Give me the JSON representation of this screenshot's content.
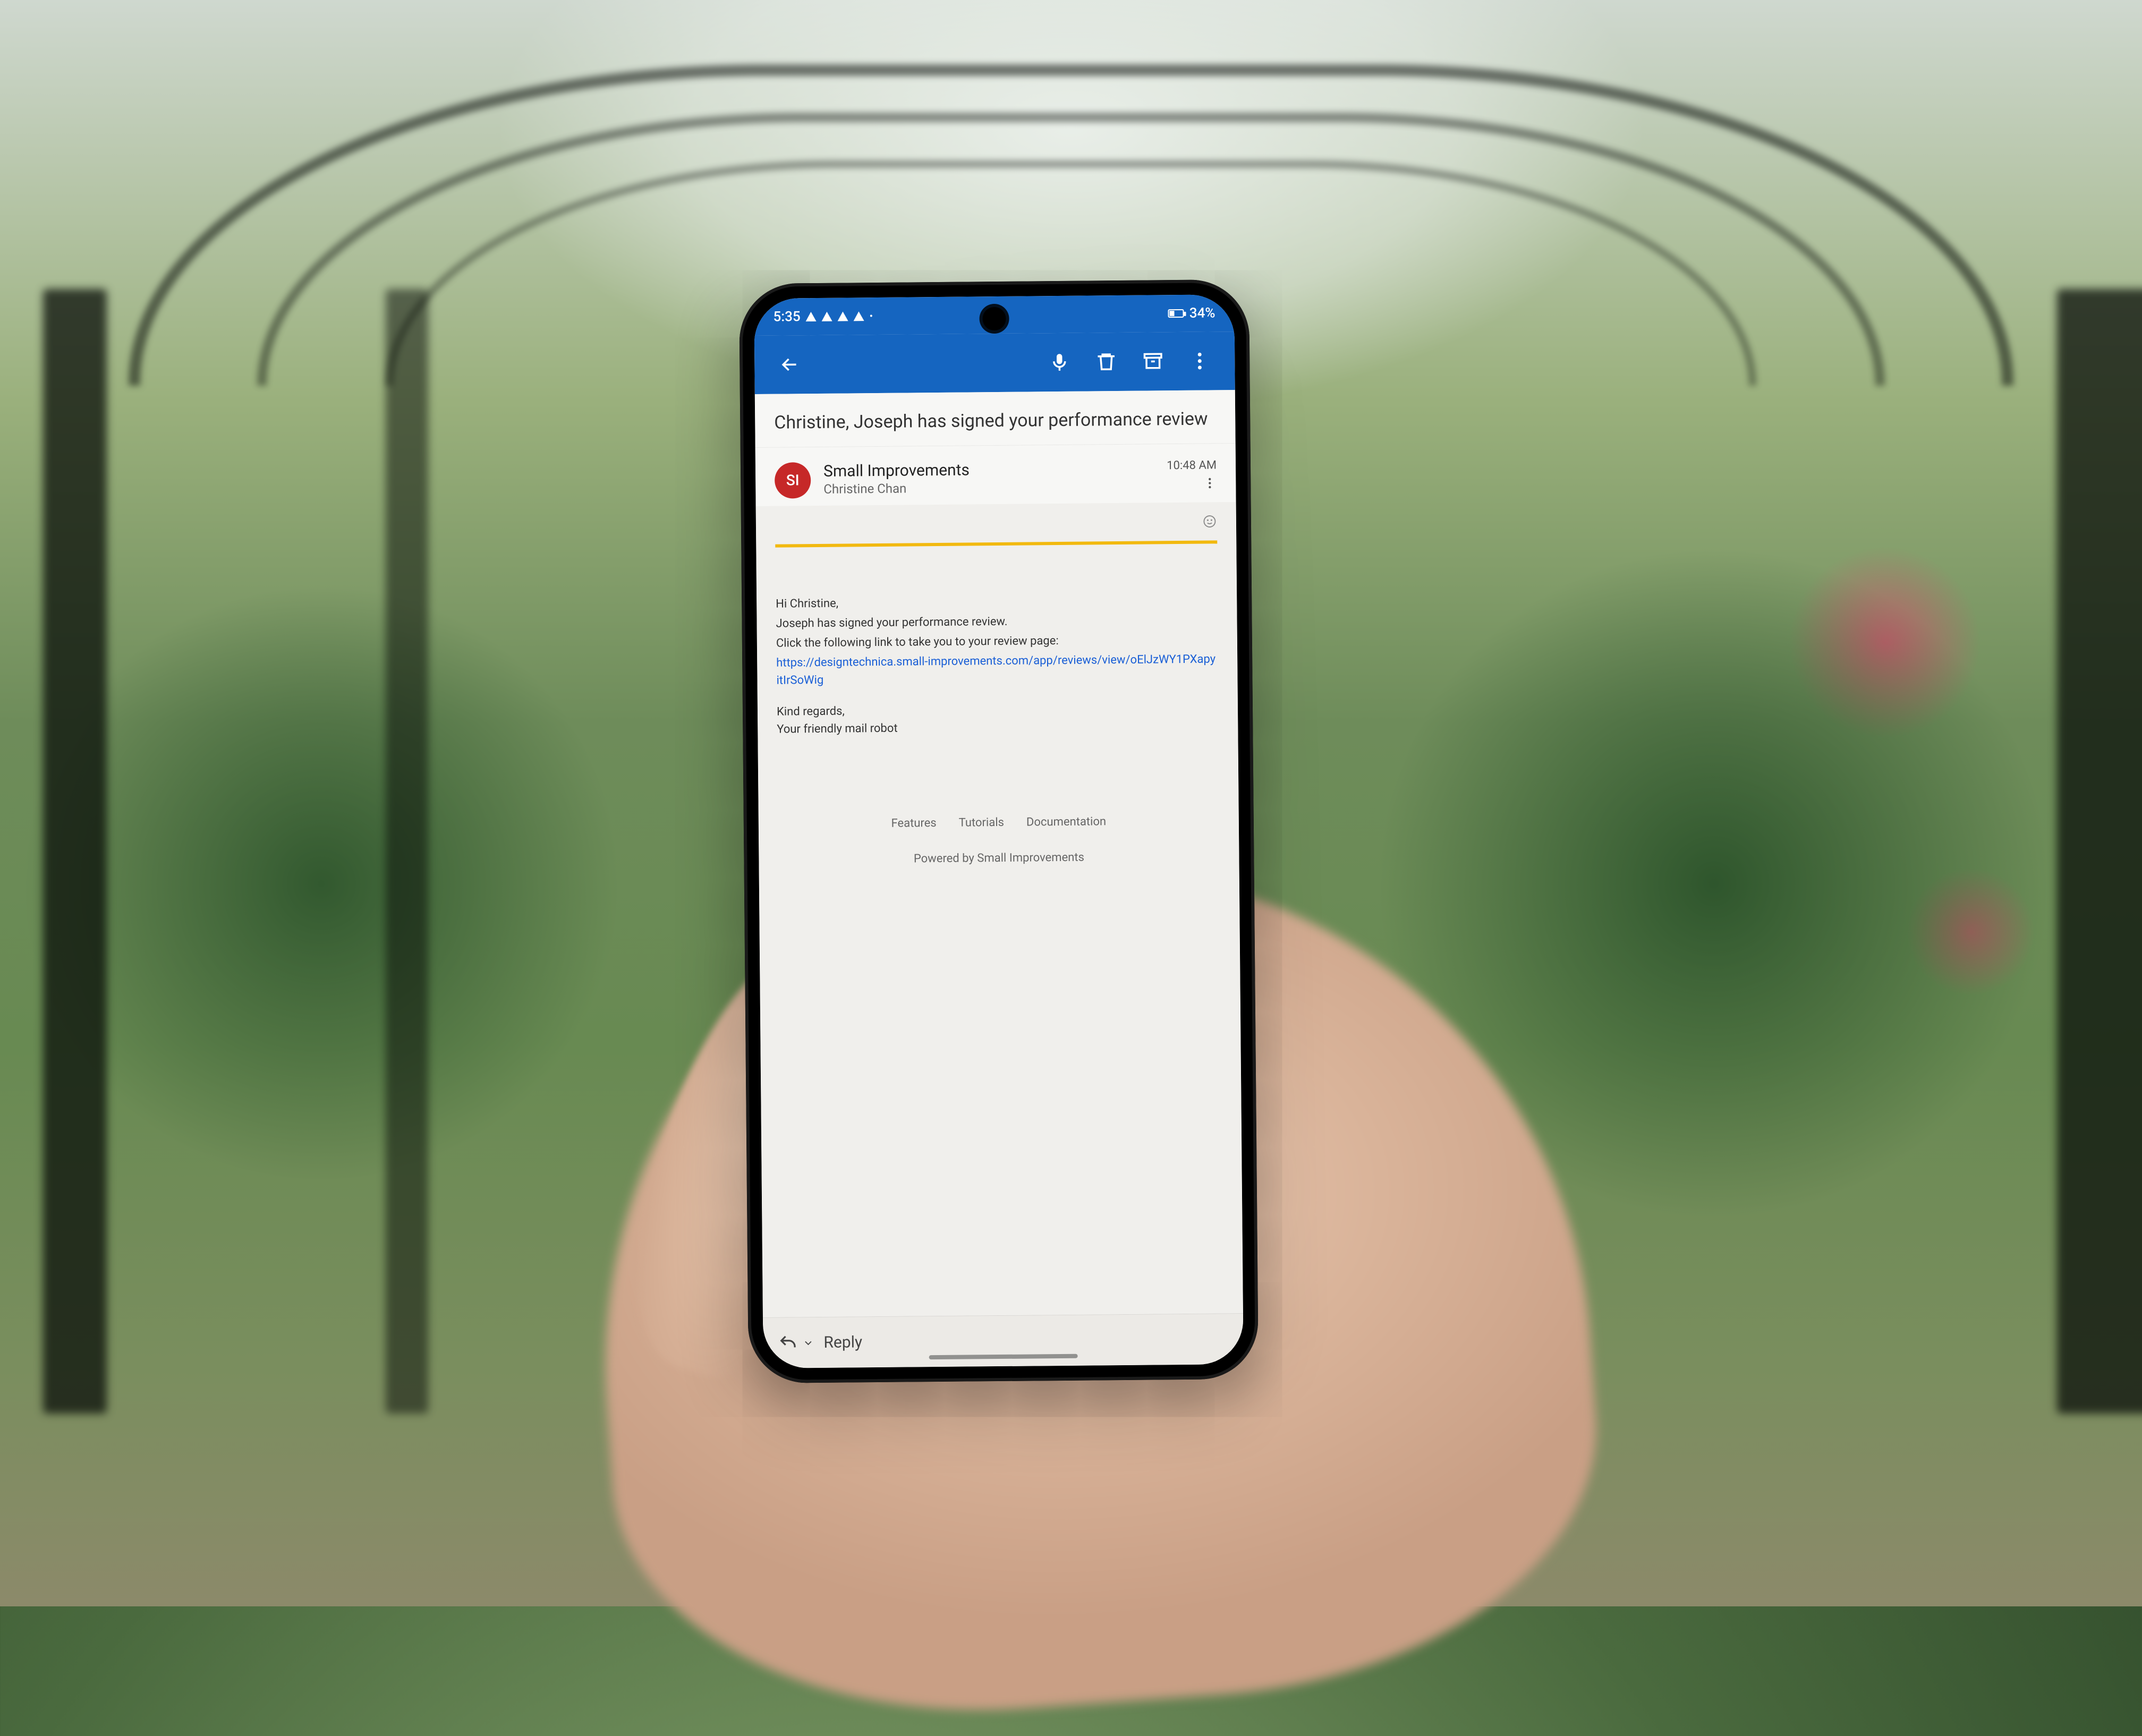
{
  "status": {
    "time": "5:35",
    "battery_pct": "34%"
  },
  "subject": "Christine, Joseph has signed your performance review",
  "sender": {
    "avatar_initials": "SI",
    "name": "Small Improvements",
    "recipient": "Christine Chan",
    "time": "10:48 AM"
  },
  "body": {
    "greeting": "Hi Christine,",
    "line1": "Joseph has signed your performance review.",
    "line2": "Click the following link to take you to your review page:",
    "link": "https://designtechnica.small-improvements.com/app/reviews/view/oElJzWY1PXapyitIrSoWig",
    "closing1": "Kind regards,",
    "closing2": "Your friendly mail robot"
  },
  "footer": {
    "links": [
      "Features",
      "Tutorials",
      "Documentation"
    ],
    "powered": "Powered by Small Improvements"
  },
  "reply": {
    "label": "Reply"
  }
}
